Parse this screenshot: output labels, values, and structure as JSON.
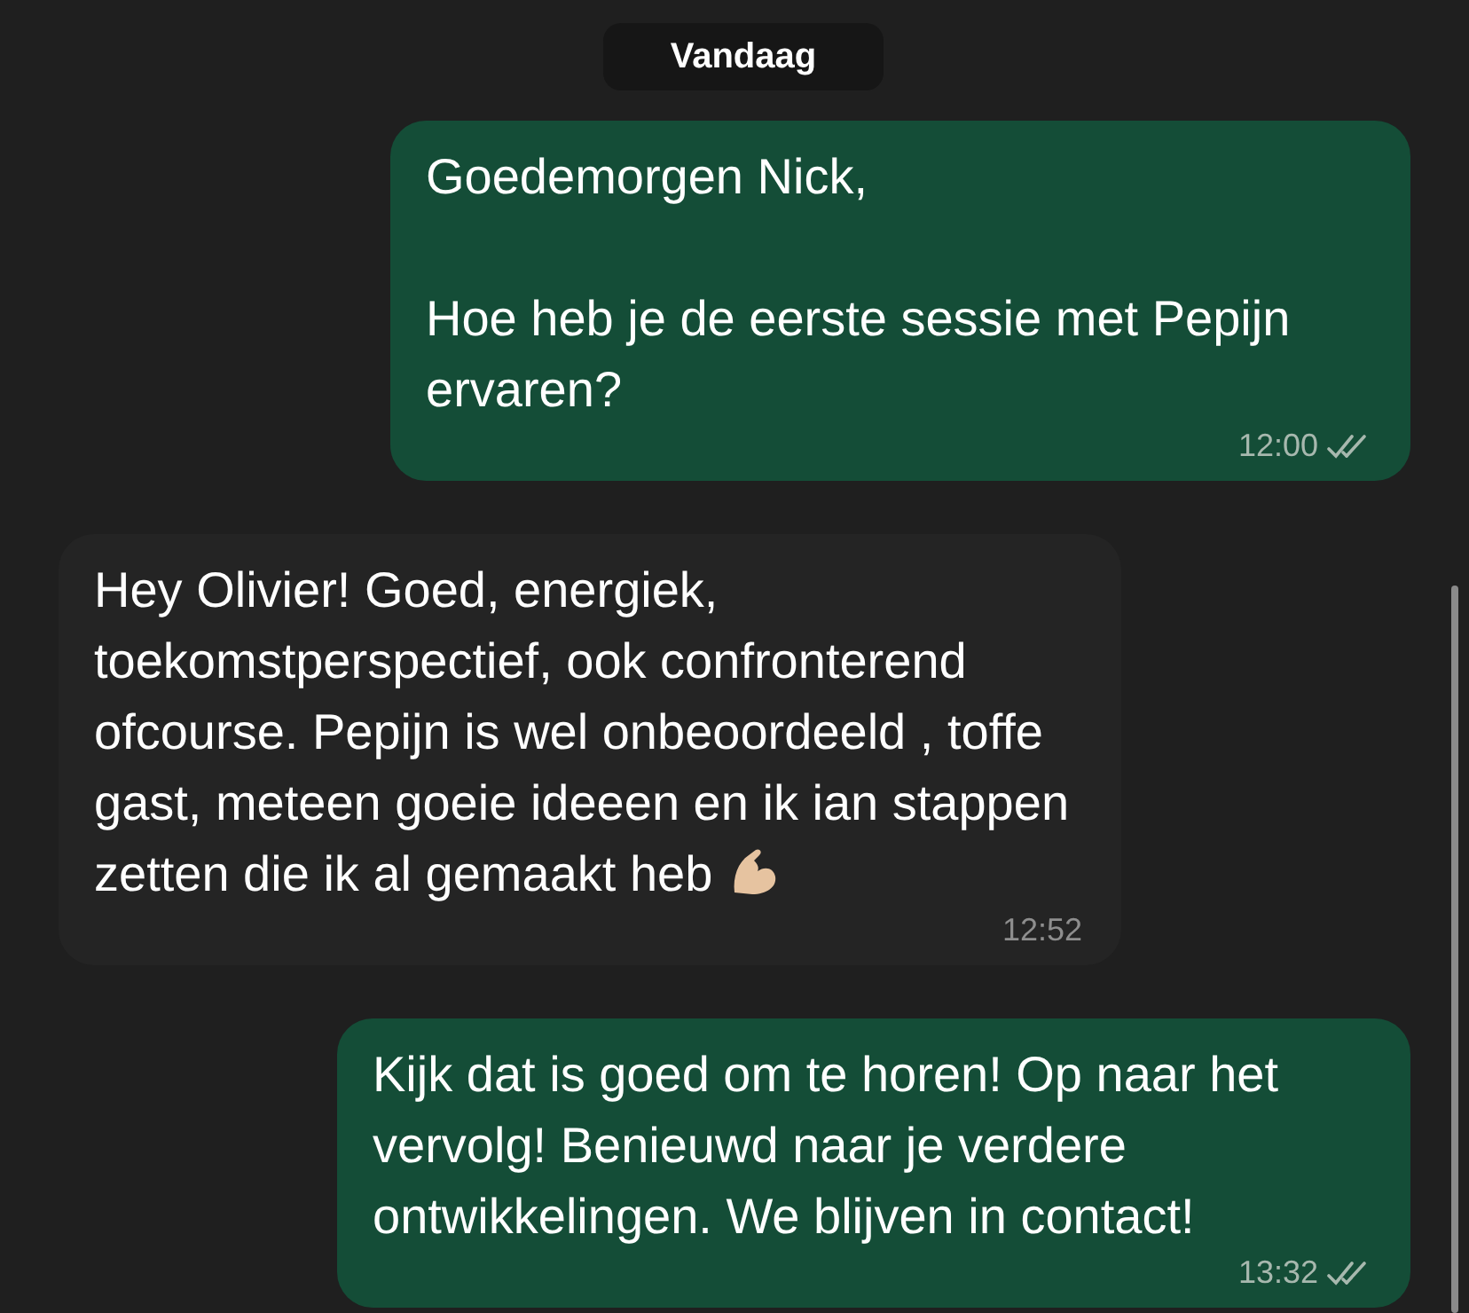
{
  "date_label": "Vandaag",
  "messages": [
    {
      "kind": "outgoing",
      "text": "Goedemorgen Nick,\n\nHoe heb je de eerste sessie met Pepijn ervaren?",
      "time": "12:00",
      "read": true
    },
    {
      "kind": "incoming",
      "text": "Hey Olivier! Goed, energiek, toekomstperspectief, ook confronterend ofcourse. Pepijn is wel onbeoordeeld , toffe gast, meteen goeie ideeen en ik ian stappen zetten die ik al gemaakt heb",
      "time": "12:52",
      "emoji": true
    },
    {
      "kind": "outgoing",
      "text": "Kijk dat is goed om te horen! Op naar het vervolg! Benieuwd naar je verdere ontwikkelingen. We blijven in contact!",
      "time": "13:32",
      "read": true
    }
  ]
}
